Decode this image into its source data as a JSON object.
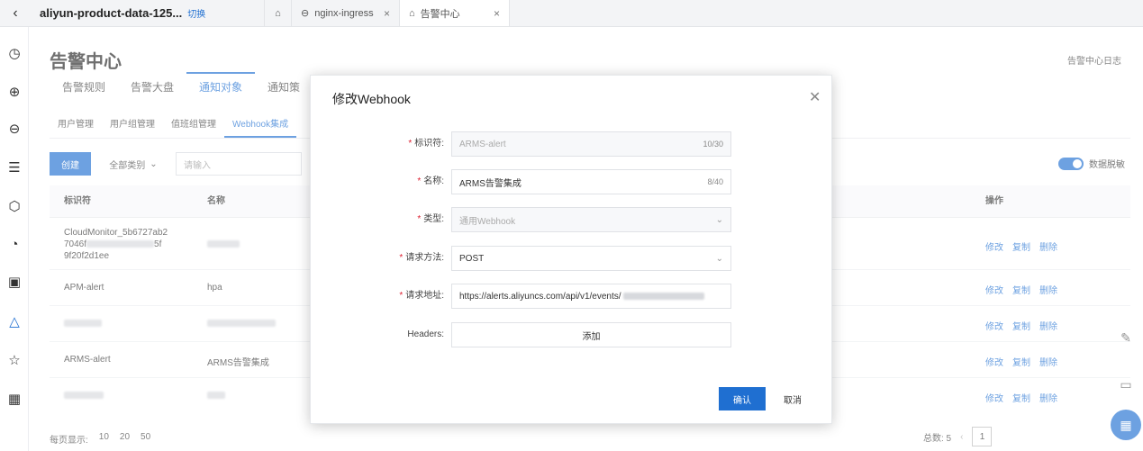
{
  "tabbar": {
    "back_icon": "chevron-left-icon",
    "tabs": [
      {
        "label": "aliyun-product-data-125...",
        "badge": "切换"
      },
      {
        "label": "nginx-ingress",
        "close": "×"
      },
      {
        "label": "告警中心",
        "close": "×"
      }
    ]
  },
  "sidebar": {
    "icons": [
      "clock-icon",
      "search-circle-icon",
      "zoom-icon",
      "list-icon",
      "cube-icon",
      "chart-pie-icon",
      "monitor-icon",
      "bell-icon",
      "star-icon",
      "grid-icon"
    ],
    "active": "bell-icon"
  },
  "page": {
    "title": "告警中心",
    "log_link": "告警中心日志"
  },
  "main_tabs": [
    "告警规则",
    "告警大盘",
    "通知对象",
    "通知策"
  ],
  "sub_tabs": [
    "用户管理",
    "用户组管理",
    "值班组管理",
    "Webhook集成"
  ],
  "toolbar": {
    "create": "创建",
    "all_types": "全部类别",
    "search_placeholder": "请输入",
    "toggle_label": "数据脱敏"
  },
  "table": {
    "headers": {
      "id": "标识符",
      "name": "名称",
      "actions": "操作"
    },
    "rows": [
      {
        "id_line1": "CloudMonitor_5b6727ab2",
        "id_line2_pre": "7046f",
        "id_line2_post": "5f",
        "id_line3": "9f20f2d1ee",
        "name": ""
      },
      {
        "id_line1": "APM-alert",
        "name": "hpa"
      },
      {
        "id_line1": "",
        "name": ""
      },
      {
        "id_line1": "ARMS-alert",
        "name": "ARMS告警集成"
      },
      {
        "id_line1": "",
        "name": ""
      }
    ],
    "action_labels": [
      "修改",
      "复制",
      "删除"
    ]
  },
  "footer": {
    "per_page_label": "每页显示:",
    "sizes": [
      "10",
      "20",
      "50"
    ],
    "total": "总数: 5",
    "current_page": "1"
  },
  "dialog": {
    "title": "修改Webhook",
    "fields": {
      "identifier": {
        "label": "标识符:",
        "value": "ARMS-alert",
        "count": "10/30"
      },
      "name": {
        "label": "名称:",
        "value": "ARMS告警集成",
        "count": "8/40"
      },
      "type": {
        "label": "类型:",
        "value": "通用Webhook"
      },
      "method": {
        "label": "请求方法:",
        "value": "POST"
      },
      "url": {
        "label": "请求地址:",
        "value": "https://alerts.aliyuncs.com/api/v1/events/"
      },
      "headers": {
        "label": "Headers:",
        "button": "添加"
      }
    },
    "ok": "确认",
    "cancel": "取消"
  },
  "colors": {
    "accent": "#1f6fd1"
  }
}
